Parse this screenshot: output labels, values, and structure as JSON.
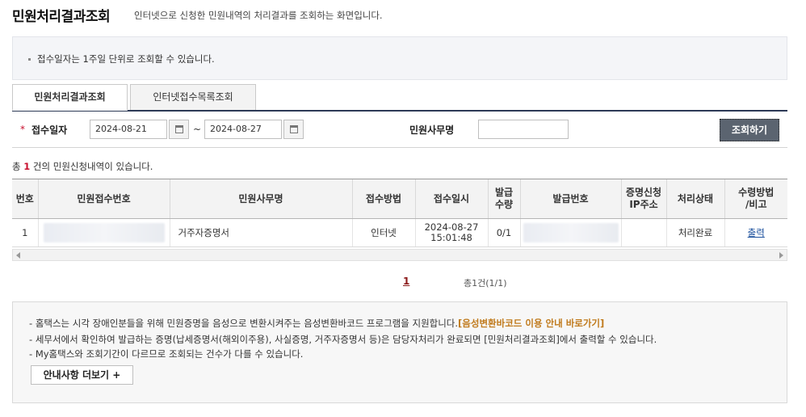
{
  "header": {
    "title": "민원처리결과조회",
    "description": "인터넷으로 신청한 민원내역의 처리결과를 조회하는 화면입니다."
  },
  "notice": {
    "text": "접수일자는 1주일 단위로 조회할 수 있습니다."
  },
  "tabs": [
    {
      "label": "민원처리결과조회",
      "active": true
    },
    {
      "label": "인터넷접수목록조회",
      "active": false
    }
  ],
  "search": {
    "required_mark": "*",
    "date_label": "접수일자",
    "date_from": "2024-08-21",
    "date_to": "2024-08-27",
    "separator": "~",
    "office_label": "민원사무명",
    "office_value": "",
    "search_button": "조회하기"
  },
  "result": {
    "prefix": "총 ",
    "count": "1",
    "suffix": " 건의 민원신청내역이 있습니다."
  },
  "table": {
    "headers": [
      "번호",
      "민원접수번호",
      "민원사무명",
      "접수방법",
      "접수일시",
      "발급\n수량",
      "발급번호",
      "증명신청\nIP주소",
      "처리상태",
      "수령방법\n/비고"
    ],
    "rows": [
      {
        "no": "1",
        "receipt_no": "",
        "office_name": "거주자증명서",
        "method": "인터넷",
        "date": "2024-08-27",
        "time": "15:01:48",
        "qty": "0/1",
        "issue_no": "",
        "ip": "",
        "status": "처리완료",
        "action": "출력"
      }
    ]
  },
  "pager": {
    "current": "1",
    "total": "총1건(1/1)"
  },
  "info": {
    "line1": "홈택스는 시각 장애인분들을 위해 민원증명을 음성으로 변환시켜주는 음성변환바코드 프로그램을 지원합니다.",
    "line1_link": "[음성변환바코드 이용 안내 바로가기]",
    "line2": "세무서에서 확인하여 발급하는 증명(납세증명서(해외이주용), 사실증명, 거주자증명서 등)은 담당자처리가 완료되면 [민원처리결과조회]에서 출력할 수 있습니다.",
    "line3": "My홈택스와 조회기간이 다르므로 조회되는 건수가 다를 수 있습니다.",
    "more_button": "안내사항 더보기 +"
  },
  "colors": {
    "accent": "#c8102e",
    "header_bar": "#2d3a56",
    "button": "#5b6470",
    "link": "#1a4f9c"
  }
}
